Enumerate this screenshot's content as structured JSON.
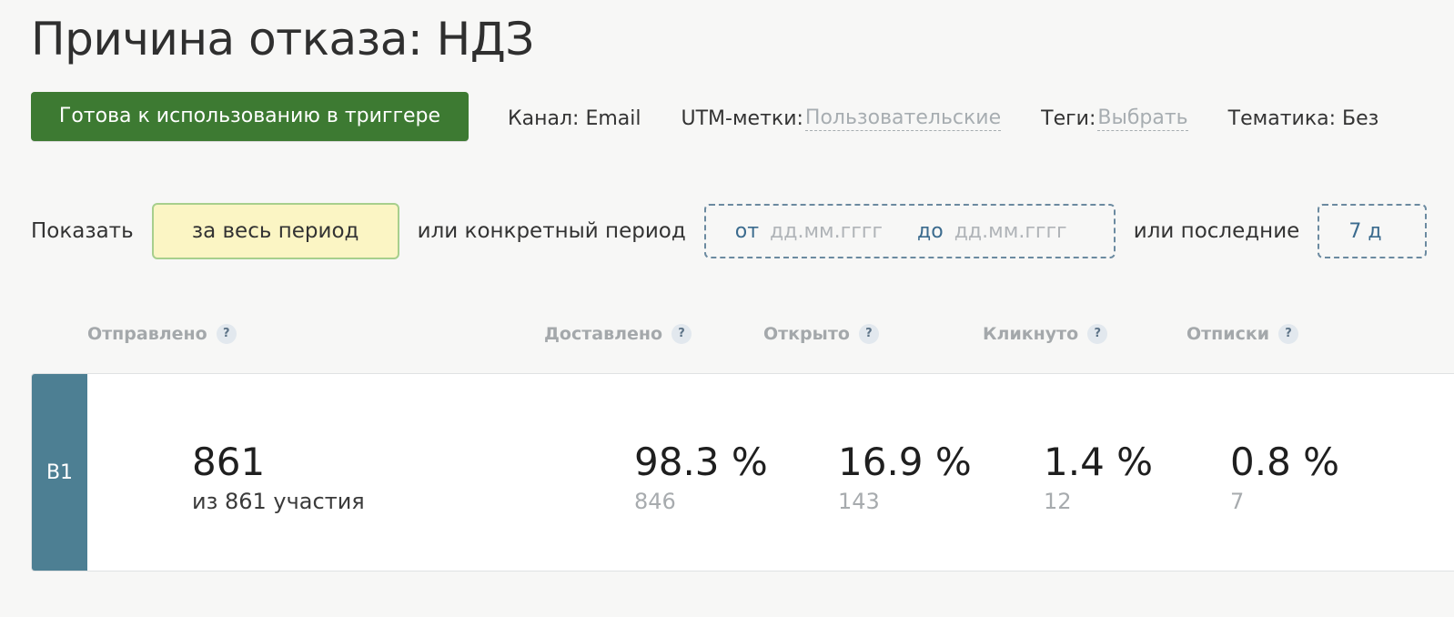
{
  "title": "Причина отказа: НДЗ",
  "status_button": "Готова к использованию в триггере",
  "meta": {
    "channel_label": "Канал:",
    "channel_value": "Email",
    "utm_label": "UTM-метки:",
    "utm_value": "Пользовательские",
    "tags_label": "Теги:",
    "tags_value": "Выбрать",
    "topic_label": "Тематика:",
    "topic_value": "Без"
  },
  "period": {
    "show_label": "Показать",
    "all_time_button": "за весь период",
    "or_specific": "или конкретный период",
    "from_word": "от",
    "from_placeholder": "дд.мм.гггг",
    "to_word": "до",
    "to_placeholder": "дд.мм.гггг",
    "or_last": "или последние",
    "last_days_value": "7 д"
  },
  "columns": {
    "sent": "Отправлено",
    "delivered": "Доставлено",
    "opened": "Открыто",
    "clicked": "Кликнуто",
    "unsubscribed": "Отписки",
    "help": "?"
  },
  "row": {
    "variant": "B1",
    "sent_value": "861",
    "sent_sub": "из 861 участия",
    "delivered_pct": "98.3 %",
    "delivered_count": "846",
    "opened_pct": "16.9 %",
    "opened_count": "143",
    "clicked_pct": "1.4 %",
    "clicked_count": "12",
    "unsub_pct": "0.8 %",
    "unsub_count": "7"
  },
  "colors": {
    "status_green": "#3d7a32",
    "variant_blue": "#4d7f93",
    "period_highlight": "#fbf5c4"
  }
}
